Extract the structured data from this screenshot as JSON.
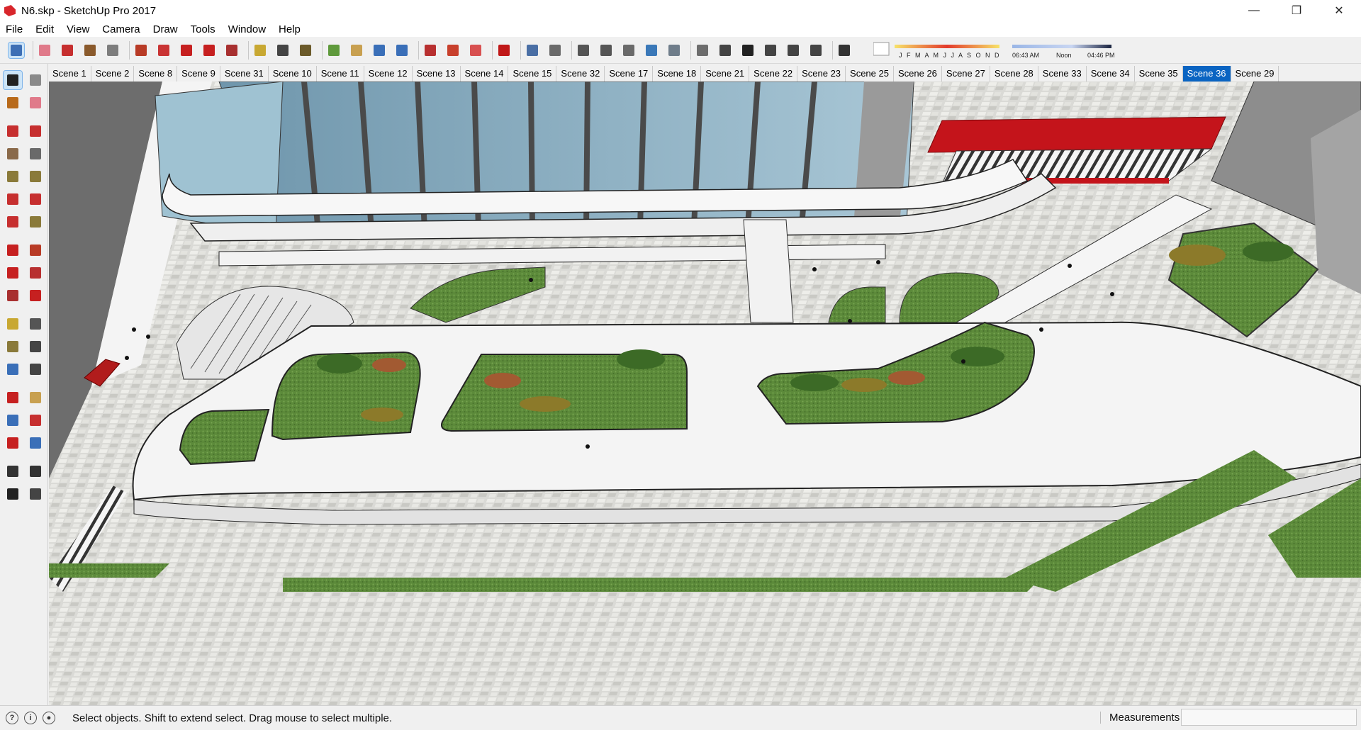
{
  "window": {
    "title": "N6.skp - SketchUp Pro 2017",
    "controls": {
      "minimize": "—",
      "maximize": "❐",
      "close": "✕"
    }
  },
  "menu": [
    "File",
    "Edit",
    "View",
    "Camera",
    "Draw",
    "Tools",
    "Window",
    "Help"
  ],
  "shadow_settings": {
    "months": "J F M A M J J A S O N D",
    "time_start": "06:43 AM",
    "time_mid": "Noon",
    "time_end": "04:46 PM"
  },
  "scenes": [
    "Scene 1",
    "Scene 2",
    "Scene 8",
    "Scene 9",
    "Scene 31",
    "Scene 10",
    "Scene 11",
    "Scene 12",
    "Scene 13",
    "Scene 14",
    "Scene 15",
    "Scene 32",
    "Scene 17",
    "Scene 18",
    "Scene 21",
    "Scene 22",
    "Scene 23",
    "Scene 25",
    "Scene 26",
    "Scene 27",
    "Scene 28",
    "Scene 33",
    "Scene 34",
    "Scene 35",
    "Scene 36",
    "Scene 29"
  ],
  "active_scene": "Scene 36",
  "toolbar_icons": [
    "select-icon",
    "eraser-icon",
    "line-icon",
    "arc-icon",
    "rectangle-icon",
    "push-pull-icon",
    "follow-me-icon",
    "move-icon",
    "rotate-icon",
    "scale-icon",
    "tape-measure-icon",
    "text-icon",
    "paint-bucket-icon",
    "orbit-icon",
    "pan-icon",
    "zoom-icon",
    "zoom-extents-icon",
    "3d-warehouse-icon",
    "extension-warehouse-icon",
    "layout-icon",
    "ruby-icon",
    "xray-icon",
    "back-edges-icon",
    "wireframe-icon",
    "hidden-line-icon",
    "shaded-icon",
    "shaded-textures-icon",
    "monochrome-icon",
    "iso-view-icon",
    "top-view-icon",
    "front-view-icon",
    "right-view-icon",
    "back-view-icon",
    "left-view-icon",
    "shadows-icon"
  ],
  "left_tools": [
    "select-icon",
    "make-component-icon",
    "paint-bucket-icon",
    "eraser-icon",
    "line-icon",
    "freehand-icon",
    "rectangle-icon",
    "rotated-rectangle-icon",
    "circle-icon",
    "polygon-icon",
    "arc-icon",
    "two-point-arc-icon",
    "three-point-arc-icon",
    "pie-icon",
    "move-icon",
    "push-pull-icon",
    "rotate-icon",
    "follow-me-icon",
    "scale-icon",
    "offset-icon",
    "tape-measure-icon",
    "dimension-icon",
    "protractor-icon",
    "text-icon",
    "axes-icon",
    "3d-text-icon",
    "orbit-icon",
    "pan-icon",
    "zoom-icon",
    "zoom-window-icon",
    "zoom-extents-icon",
    "previous-view-icon",
    "position-camera-icon",
    "look-around-icon",
    "walk-icon",
    "section-plane-icon"
  ],
  "colors": {
    "accent": "#0a64c2",
    "glass": "#8fb4c6",
    "red_canopy": "#c4141b",
    "grass": "#5f8a3c",
    "paving": "#d6d6d2",
    "road": "#6f6f6f"
  },
  "status": {
    "message": "Select objects. Shift to extend select. Drag mouse to select multiple.",
    "measurements_label": "Measurements",
    "measurements_value": ""
  }
}
